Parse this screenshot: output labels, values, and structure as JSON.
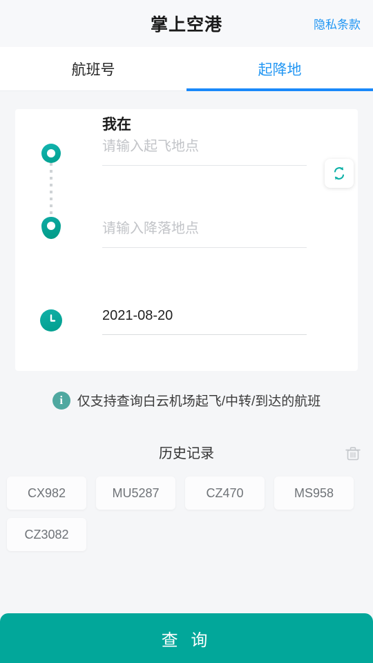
{
  "header": {
    "title": "掌上空港",
    "privacy_label": "隐私条款"
  },
  "tabs": [
    {
      "label": "航班号",
      "active": false
    },
    {
      "label": "起降地",
      "active": true
    }
  ],
  "form": {
    "depart": {
      "label": "我在",
      "placeholder": "请输入起飞地点",
      "value": ""
    },
    "arrive": {
      "label": "",
      "placeholder": "请输入降落地点",
      "value": ""
    },
    "date": {
      "value": "2021-08-20"
    },
    "swap_icon": "swap-arrows-icon",
    "clock_icon": "clock-icon"
  },
  "notice": {
    "icon": "info-icon",
    "text": "仅支持查询白云机场起飞/中转/到达的航班"
  },
  "history": {
    "title": "历史记录",
    "clear_icon": "trash-icon",
    "items": [
      "CX982",
      "MU5287",
      "CZ470",
      "MS958",
      "CZ3082"
    ]
  },
  "submit": {
    "label": "查 询"
  },
  "colors": {
    "accent_teal": "#02a79a",
    "link_blue": "#2196f3",
    "tab_indicator": "#1989fa",
    "page_bg": "#f5f6f8",
    "card_bg": "#ffffff",
    "placeholder": "#c2c4c8"
  }
}
